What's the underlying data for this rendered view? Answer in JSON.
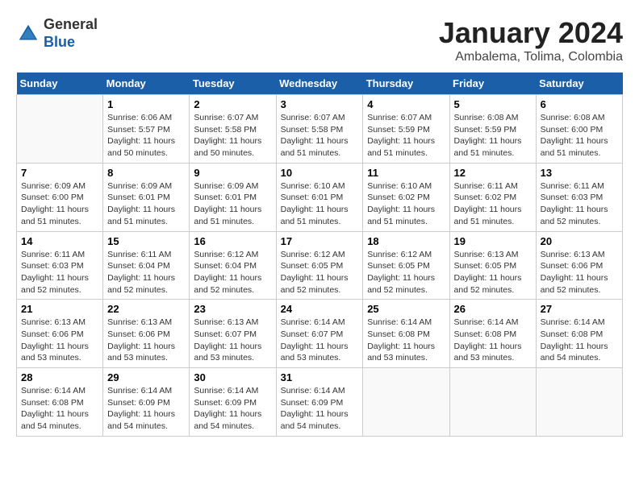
{
  "header": {
    "logo_general": "General",
    "logo_blue": "Blue",
    "title": "January 2024",
    "subtitle": "Ambalema, Tolima, Colombia"
  },
  "days_of_week": [
    "Sunday",
    "Monday",
    "Tuesday",
    "Wednesday",
    "Thursday",
    "Friday",
    "Saturday"
  ],
  "weeks": [
    [
      {
        "day": "",
        "empty": true
      },
      {
        "day": "1",
        "sunrise": "6:06 AM",
        "sunset": "5:57 PM",
        "daylight": "11 hours and 50 minutes."
      },
      {
        "day": "2",
        "sunrise": "6:07 AM",
        "sunset": "5:58 PM",
        "daylight": "11 hours and 50 minutes."
      },
      {
        "day": "3",
        "sunrise": "6:07 AM",
        "sunset": "5:58 PM",
        "daylight": "11 hours and 51 minutes."
      },
      {
        "day": "4",
        "sunrise": "6:07 AM",
        "sunset": "5:59 PM",
        "daylight": "11 hours and 51 minutes."
      },
      {
        "day": "5",
        "sunrise": "6:08 AM",
        "sunset": "5:59 PM",
        "daylight": "11 hours and 51 minutes."
      },
      {
        "day": "6",
        "sunrise": "6:08 AM",
        "sunset": "6:00 PM",
        "daylight": "11 hours and 51 minutes."
      }
    ],
    [
      {
        "day": "7",
        "sunrise": "6:09 AM",
        "sunset": "6:00 PM",
        "daylight": "11 hours and 51 minutes."
      },
      {
        "day": "8",
        "sunrise": "6:09 AM",
        "sunset": "6:01 PM",
        "daylight": "11 hours and 51 minutes."
      },
      {
        "day": "9",
        "sunrise": "6:09 AM",
        "sunset": "6:01 PM",
        "daylight": "11 hours and 51 minutes."
      },
      {
        "day": "10",
        "sunrise": "6:10 AM",
        "sunset": "6:01 PM",
        "daylight": "11 hours and 51 minutes."
      },
      {
        "day": "11",
        "sunrise": "6:10 AM",
        "sunset": "6:02 PM",
        "daylight": "11 hours and 51 minutes."
      },
      {
        "day": "12",
        "sunrise": "6:11 AM",
        "sunset": "6:02 PM",
        "daylight": "11 hours and 51 minutes."
      },
      {
        "day": "13",
        "sunrise": "6:11 AM",
        "sunset": "6:03 PM",
        "daylight": "11 hours and 52 minutes."
      }
    ],
    [
      {
        "day": "14",
        "sunrise": "6:11 AM",
        "sunset": "6:03 PM",
        "daylight": "11 hours and 52 minutes."
      },
      {
        "day": "15",
        "sunrise": "6:11 AM",
        "sunset": "6:04 PM",
        "daylight": "11 hours and 52 minutes."
      },
      {
        "day": "16",
        "sunrise": "6:12 AM",
        "sunset": "6:04 PM",
        "daylight": "11 hours and 52 minutes."
      },
      {
        "day": "17",
        "sunrise": "6:12 AM",
        "sunset": "6:05 PM",
        "daylight": "11 hours and 52 minutes."
      },
      {
        "day": "18",
        "sunrise": "6:12 AM",
        "sunset": "6:05 PM",
        "daylight": "11 hours and 52 minutes."
      },
      {
        "day": "19",
        "sunrise": "6:13 AM",
        "sunset": "6:05 PM",
        "daylight": "11 hours and 52 minutes."
      },
      {
        "day": "20",
        "sunrise": "6:13 AM",
        "sunset": "6:06 PM",
        "daylight": "11 hours and 52 minutes."
      }
    ],
    [
      {
        "day": "21",
        "sunrise": "6:13 AM",
        "sunset": "6:06 PM",
        "daylight": "11 hours and 53 minutes."
      },
      {
        "day": "22",
        "sunrise": "6:13 AM",
        "sunset": "6:06 PM",
        "daylight": "11 hours and 53 minutes."
      },
      {
        "day": "23",
        "sunrise": "6:13 AM",
        "sunset": "6:07 PM",
        "daylight": "11 hours and 53 minutes."
      },
      {
        "day": "24",
        "sunrise": "6:14 AM",
        "sunset": "6:07 PM",
        "daylight": "11 hours and 53 minutes."
      },
      {
        "day": "25",
        "sunrise": "6:14 AM",
        "sunset": "6:08 PM",
        "daylight": "11 hours and 53 minutes."
      },
      {
        "day": "26",
        "sunrise": "6:14 AM",
        "sunset": "6:08 PM",
        "daylight": "11 hours and 53 minutes."
      },
      {
        "day": "27",
        "sunrise": "6:14 AM",
        "sunset": "6:08 PM",
        "daylight": "11 hours and 54 minutes."
      }
    ],
    [
      {
        "day": "28",
        "sunrise": "6:14 AM",
        "sunset": "6:08 PM",
        "daylight": "11 hours and 54 minutes."
      },
      {
        "day": "29",
        "sunrise": "6:14 AM",
        "sunset": "6:09 PM",
        "daylight": "11 hours and 54 minutes."
      },
      {
        "day": "30",
        "sunrise": "6:14 AM",
        "sunset": "6:09 PM",
        "daylight": "11 hours and 54 minutes."
      },
      {
        "day": "31",
        "sunrise": "6:14 AM",
        "sunset": "6:09 PM",
        "daylight": "11 hours and 54 minutes."
      },
      {
        "day": "",
        "empty": true
      },
      {
        "day": "",
        "empty": true
      },
      {
        "day": "",
        "empty": true
      }
    ]
  ]
}
